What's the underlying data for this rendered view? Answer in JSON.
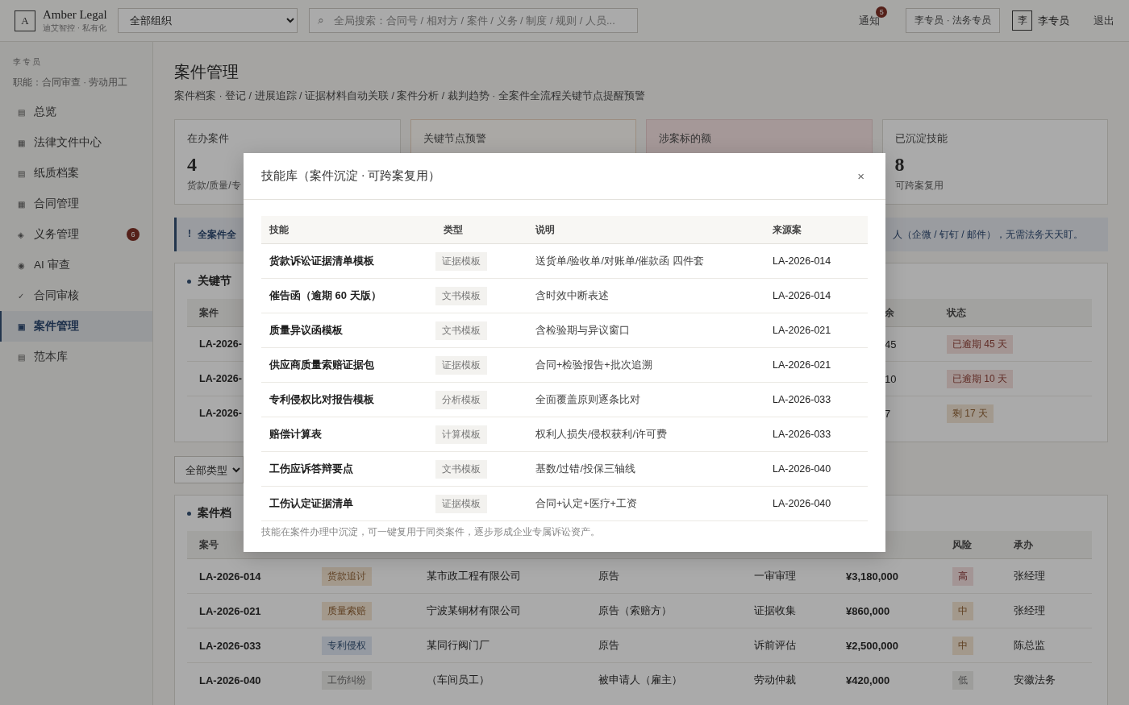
{
  "header": {
    "logo_letter": "A",
    "brand": "Amber Legal",
    "tagline": "迪艾智控 · 私有化",
    "org_select": "全部组织",
    "search_icon": "⌕",
    "search_placeholder": "全局搜索：合同号 / 相对方 / 案件 / 义务 / 制度 / 规则 / 人员...",
    "notifications": {
      "label": "通知",
      "badge": "5"
    },
    "role": "李专员 · 法务专员",
    "avatar": "李",
    "user": "李专员",
    "logout": "退出"
  },
  "sidebar": {
    "user": "李专员",
    "duties": "职能：合同审查 · 劳动用工",
    "items": [
      {
        "icon": "▤",
        "label": "总览",
        "selected": false
      },
      {
        "icon": "▦",
        "label": "法律文件中心",
        "selected": false
      },
      {
        "icon": "▤",
        "label": "纸质档案",
        "selected": false
      },
      {
        "icon": "▦",
        "label": "合同管理",
        "selected": false
      },
      {
        "icon": "◈",
        "label": "义务管理",
        "badge": "6",
        "selected": false
      },
      {
        "icon": "◉",
        "label": "AI 审查",
        "selected": false
      },
      {
        "icon": "✓",
        "label": "合同审核",
        "selected": false
      },
      {
        "icon": "▣",
        "label": "案件管理",
        "selected": true
      },
      {
        "icon": "▤",
        "label": "范本库",
        "selected": false
      }
    ]
  },
  "page": {
    "title": "案件管理",
    "subtitle": "案件档案 · 登记 / 进展追踪 / 证据材料自动关联 / 案件分析 / 裁判趋势 · 全案件全流程关键节点提醒预警"
  },
  "stats": [
    {
      "kind": "plain",
      "label": "在办案件",
      "value": "4",
      "note": "货款/质量/专"
    },
    {
      "kind": "warning",
      "label": "关键节点预警"
    },
    {
      "kind": "danger",
      "label": "涉案标的额"
    },
    {
      "kind": "plain",
      "label": "已沉淀技能",
      "value": "8",
      "note": "可跨案复用"
    }
  ],
  "alert": {
    "icon": "!",
    "lead": "全案件全",
    "tail": "人（企微 / 钉钉 / 邮件），无需法务天天盯。"
  },
  "key_nodes": {
    "title": "关键节",
    "columns": [
      "案件",
      "余",
      "状态"
    ],
    "rows": [
      {
        "case": "LA-2026-",
        "remaining": "45",
        "status": "已逾期 45 天",
        "kind": "overdue"
      },
      {
        "case": "LA-2026-",
        "remaining": "10",
        "status": "已逾期 10 天",
        "kind": "overdue"
      },
      {
        "case": "LA-2026-",
        "remaining": "7",
        "status": "剩 17 天",
        "kind": "pending"
      }
    ]
  },
  "filter": {
    "type_select": "全部类型"
  },
  "cases": {
    "title": "案件档",
    "columns": [
      "案号",
      "风险",
      "承办"
    ],
    "rows": [
      {
        "case_no": "LA-2026-014",
        "type": {
          "label": "货款追讨",
          "kind": "amber"
        },
        "party": "某市政工程有限公司",
        "role": "原告",
        "stage": "一审审理",
        "amount": "¥3,180,000",
        "risk": {
          "label": "高",
          "kind": "red"
        },
        "owner": "张经理"
      },
      {
        "case_no": "LA-2026-021",
        "type": {
          "label": "质量索赔",
          "kind": "amber"
        },
        "party": "宁波某铜材有限公司",
        "role": "原告（索赔方）",
        "stage": "证据收集",
        "amount": "¥860,000",
        "risk": {
          "label": "中",
          "kind": "amber"
        },
        "owner": "张经理"
      },
      {
        "case_no": "LA-2026-033",
        "type": {
          "label": "专利侵权",
          "kind": "blue"
        },
        "party": "某同行阀门厂",
        "role": "原告",
        "stage": "诉前评估",
        "amount": "¥2,500,000",
        "risk": {
          "label": "中",
          "kind": "amber"
        },
        "owner": "陈总监"
      },
      {
        "case_no": "LA-2026-040",
        "type": {
          "label": "工伤纠纷",
          "kind": "grey"
        },
        "party": "（车间员工）",
        "role": "被申请人（雇主）",
        "stage": "劳动仲裁",
        "amount": "¥420,000",
        "risk": {
          "label": "低",
          "kind": "grey"
        },
        "owner": "安徽法务"
      }
    ]
  },
  "modal": {
    "title": "技能库（案件沉淀 · 可跨案复用）",
    "close": "×",
    "columns": [
      "技能",
      "类型",
      "说明",
      "来源案"
    ],
    "rows": [
      {
        "skill": "货款诉讼证据清单模板",
        "type": "证据模板",
        "description": "送货单/验收单/对账单/催款函 四件套",
        "source": "LA-2026-014"
      },
      {
        "skill": "催告函（逾期 60 天版）",
        "type": "文书模板",
        "description": "含时效中断表述",
        "source": "LA-2026-014"
      },
      {
        "skill": "质量异议函模板",
        "type": "文书模板",
        "description": "含检验期与异议窗口",
        "source": "LA-2026-021"
      },
      {
        "skill": "供应商质量索赔证据包",
        "type": "证据模板",
        "description": "合同+检验报告+批次追溯",
        "source": "LA-2026-021"
      },
      {
        "skill": "专利侵权比对报告模板",
        "type": "分析模板",
        "description": "全面覆盖原则逐条比对",
        "source": "LA-2026-033"
      },
      {
        "skill": "赔偿计算表",
        "type": "计算模板",
        "description": "权利人损失/侵权获利/许可费",
        "source": "LA-2026-033"
      },
      {
        "skill": "工伤应诉答辩要点",
        "type": "文书模板",
        "description": "基数/过错/投保三轴线",
        "source": "LA-2026-040"
      },
      {
        "skill": "工伤认定证据清单",
        "type": "证据模板",
        "description": "合同+认定+医疗+工资",
        "source": "LA-2026-040"
      }
    ],
    "note": "技能在案件办理中沉淀，可一键复用于同类案件，逐步形成企业专属诉讼资产。"
  }
}
